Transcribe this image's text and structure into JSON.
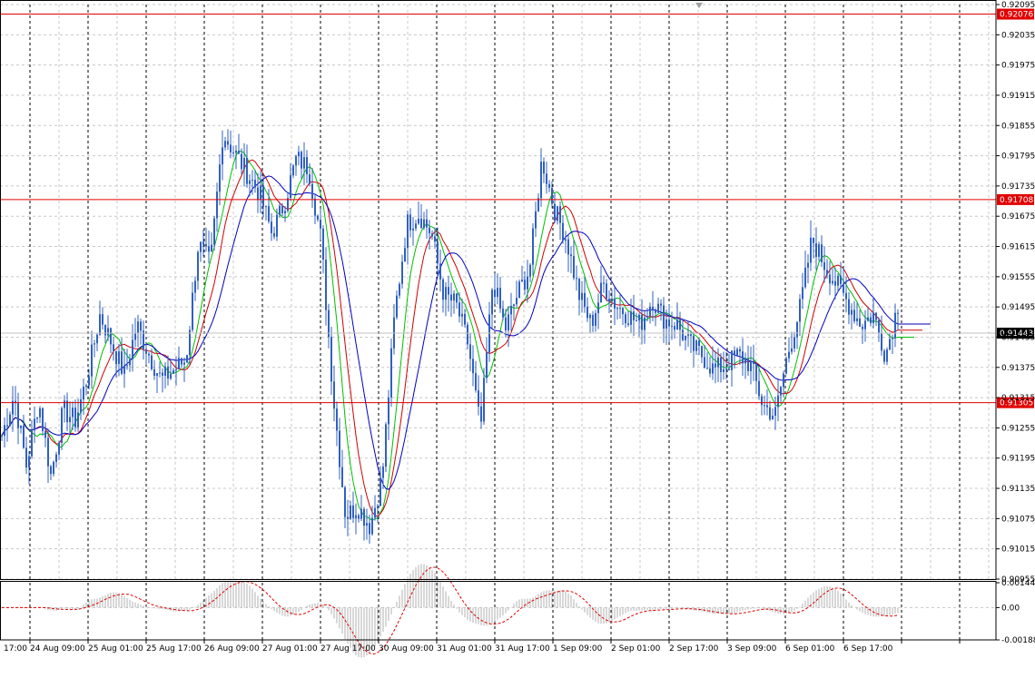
{
  "chart_data": [
    {
      "type": "candlestick",
      "panel": "main",
      "ylim": [
        0.90955,
        0.92095
      ],
      "y_ticks": [
        "0.92095",
        "0.92035",
        "0.91975",
        "0.91915",
        "0.91855",
        "0.91795",
        "0.91735",
        "0.91675",
        "0.91615",
        "0.91555",
        "0.91495",
        "0.91435",
        "0.91375",
        "0.91315",
        "0.91255",
        "0.91195",
        "0.91135",
        "0.91075",
        "0.91015",
        "0.90955"
      ],
      "x_labels": [
        "17:00",
        "24 Aug 09:00",
        "25 Aug 01:00",
        "25 Aug 17:00",
        "26 Aug 09:00",
        "27 Aug 01:00",
        "27 Aug 17:00",
        "30 Aug 09:00",
        "31 Aug 01:00",
        "31 Aug 17:00",
        "1 Sep 09:00",
        "2 Sep 01:00",
        "2 Sep 17:00",
        "3 Sep 09:00",
        "6 Sep 01:00",
        "6 Sep 17:00"
      ],
      "series_color": "#3060c0",
      "price_anchors": [
        0.9124,
        0.9132,
        0.9118,
        0.9131,
        0.9116,
        0.9129,
        0.9127,
        0.9136,
        0.9148,
        0.9142,
        0.9136,
        0.9146,
        0.914,
        0.9135,
        0.9137,
        0.9139,
        0.9162,
        0.9158,
        0.9184,
        0.918,
        0.9176,
        0.9172,
        0.9164,
        0.917,
        0.9179,
        0.9177,
        0.9163,
        0.9132,
        0.9108,
        0.911,
        0.9106,
        0.9116,
        0.9148,
        0.9166,
        0.9168,
        0.9164,
        0.9152,
        0.915,
        0.9142,
        0.9125,
        0.9155,
        0.9145,
        0.9152,
        0.9157,
        0.9179,
        0.9169,
        0.9163,
        0.9152,
        0.9146,
        0.9154,
        0.915,
        0.9148,
        0.9146,
        0.9151,
        0.9147,
        0.9146,
        0.9142,
        0.914,
        0.9137,
        0.9138,
        0.914,
        0.9138,
        0.913,
        0.9128,
        0.914,
        0.9149,
        0.9163,
        0.9158,
        0.9154,
        0.915,
        0.9146,
        0.9148,
        0.914,
        0.915
      ],
      "indicators": [
        {
          "name": "",
          "color": "#00c000"
        },
        {
          "name": "",
          "color": "#d00000"
        },
        {
          "name": "",
          "color": "#0000c0"
        }
      ],
      "horizontal_levels": [
        {
          "value": 0.92076,
          "label": "0.92076",
          "color": "#e00000"
        },
        {
          "value": 0.91708,
          "label": "0.91708",
          "color": "#e00000"
        },
        {
          "value": 0.91305,
          "label": "0.91305",
          "color": "#e00000"
        }
      ],
      "current_price": {
        "value": 0.91443,
        "label": "0.91443",
        "color": "#000000"
      }
    },
    {
      "type": "histogram",
      "panel": "oscillator",
      "y_ticks": [
        "0.001447",
        "0.00",
        "-0.00188"
      ],
      "ylim": [
        -0.00188,
        0.001447
      ],
      "bar_color": "#b0b0b0",
      "signal_color": "#e00000"
    }
  ]
}
